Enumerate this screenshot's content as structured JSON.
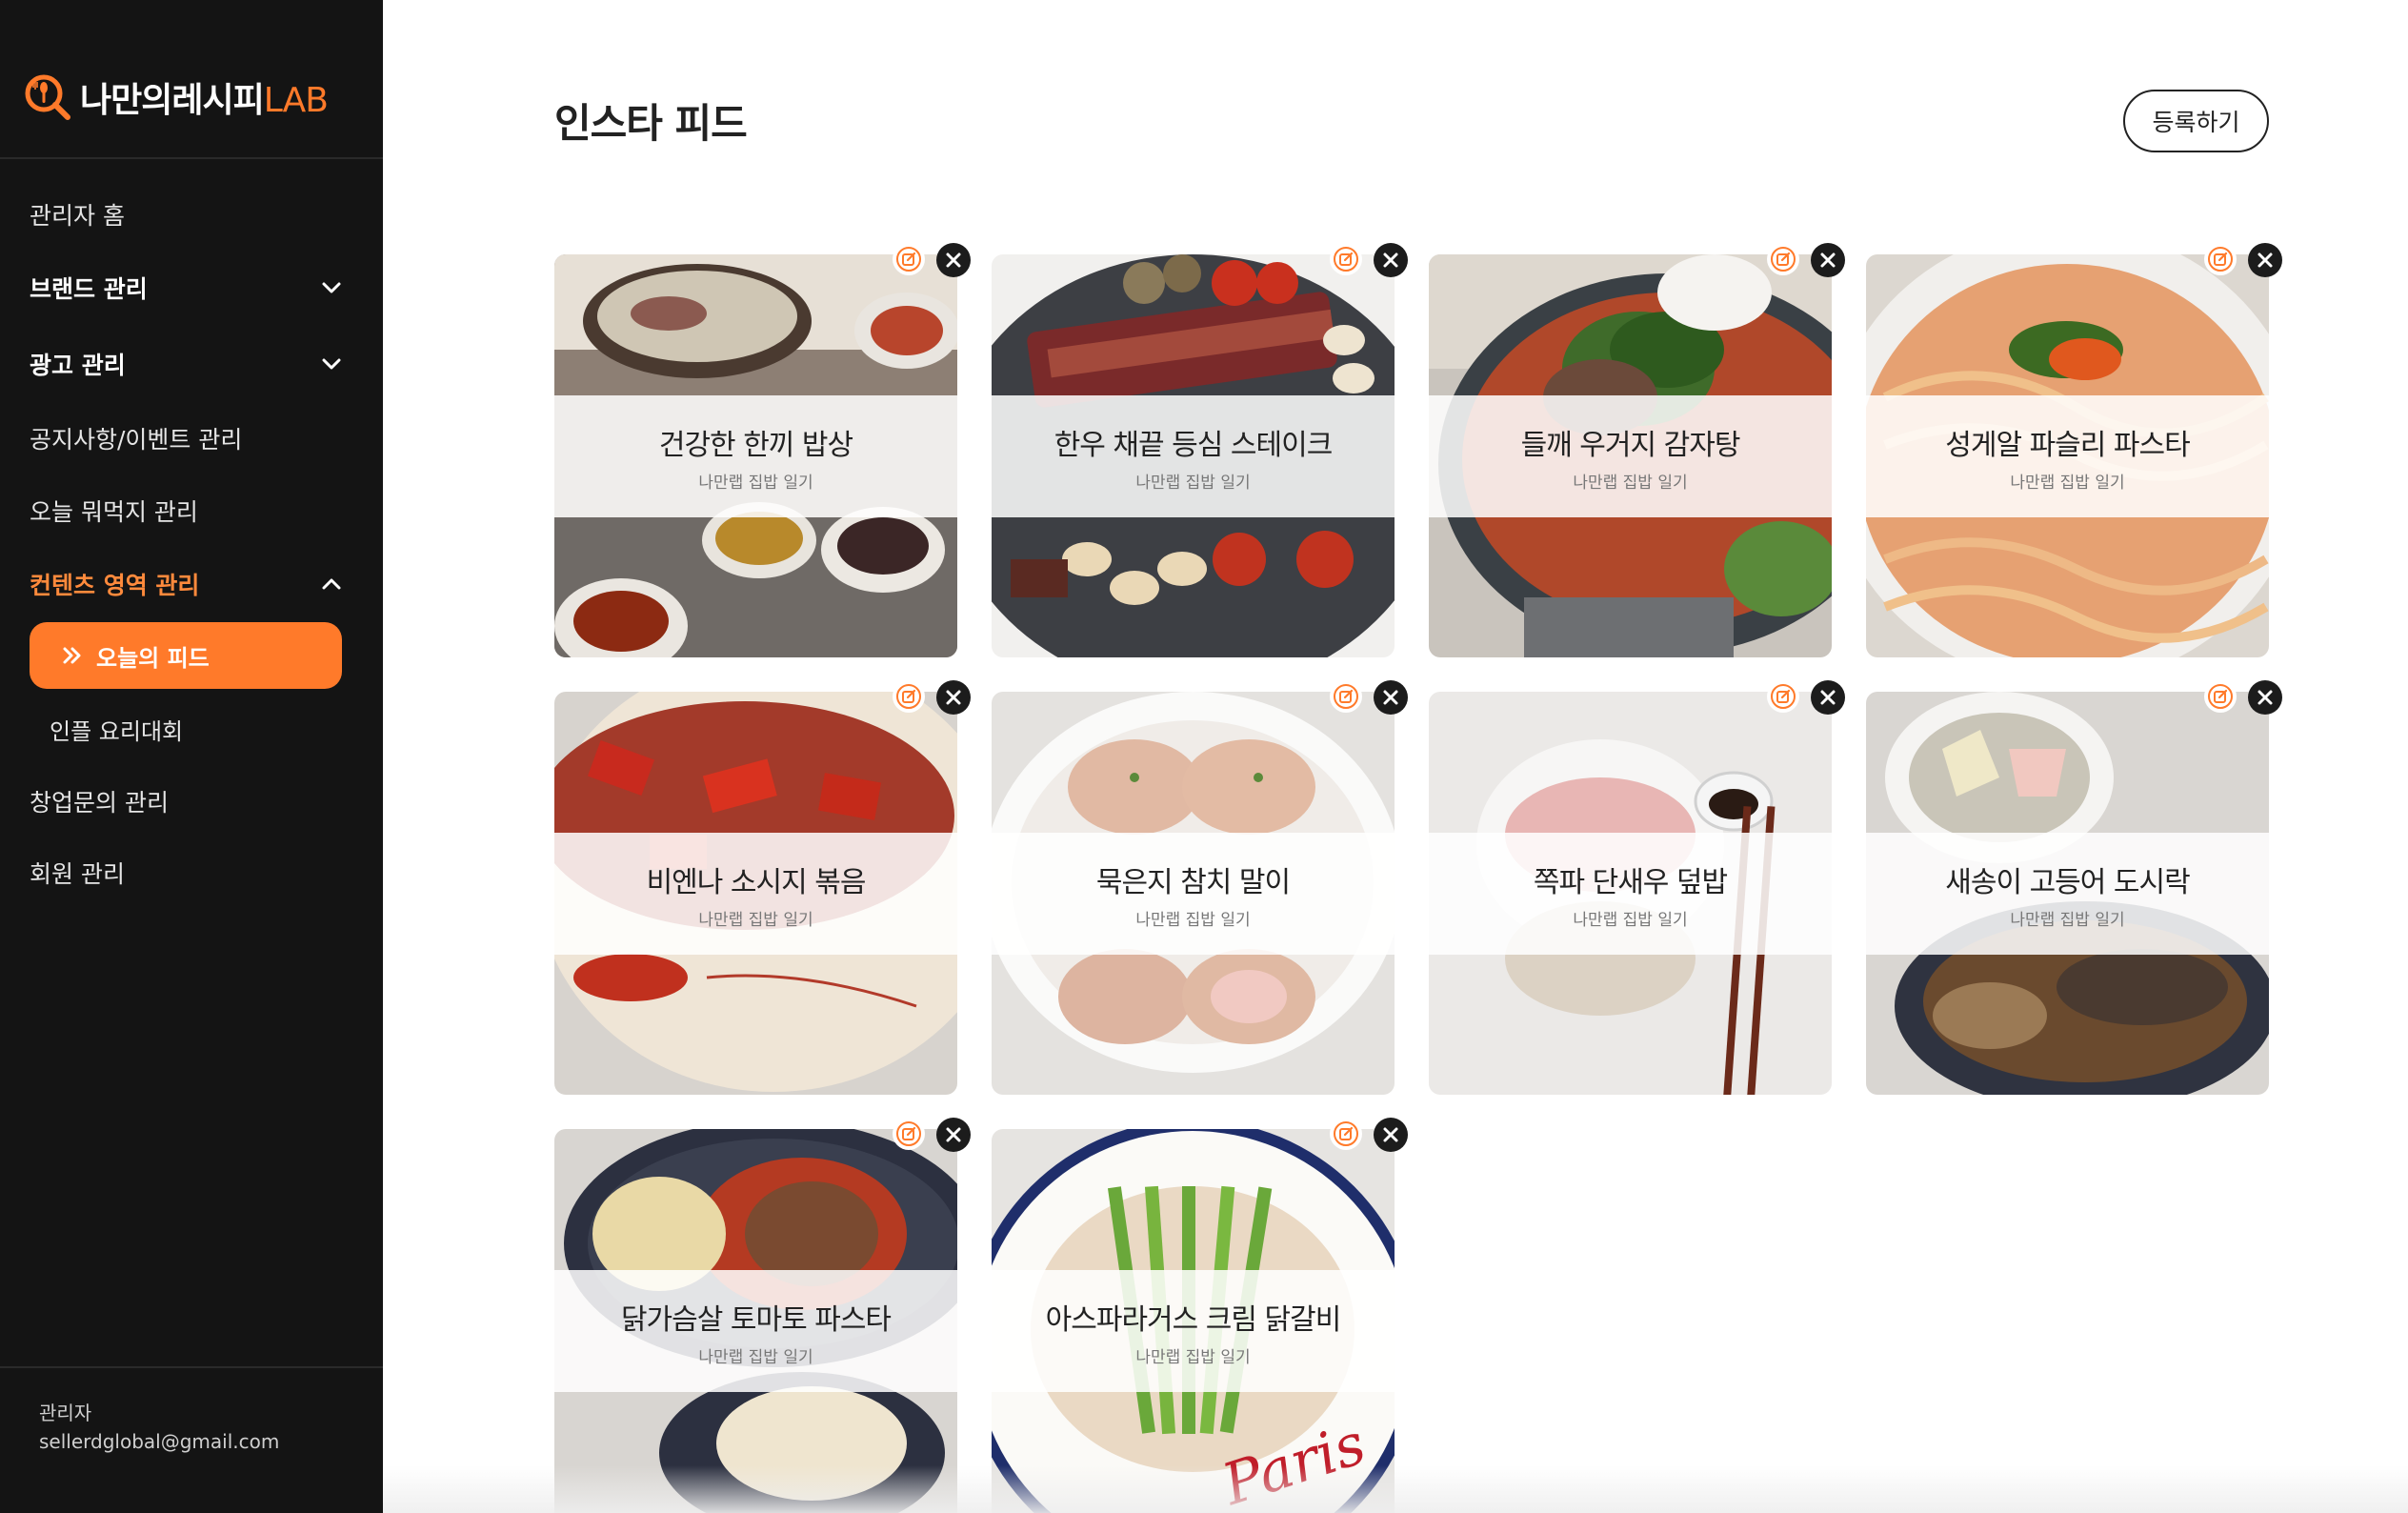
{
  "brand": {
    "name": "나만의레시피",
    "suffix": "LAB"
  },
  "sidebar": {
    "items": [
      {
        "label": "관리자 홈"
      },
      {
        "label": "브랜드 관리"
      },
      {
        "label": "광고 관리"
      },
      {
        "label": "공지사항/이벤트 관리"
      },
      {
        "label": "오늘 뭐먹지 관리"
      },
      {
        "label": "컨텐츠 영역 관리"
      },
      {
        "label": "창업문의 관리"
      },
      {
        "label": "회원 관리"
      }
    ],
    "sub_items": [
      {
        "label": "오늘의 피드"
      },
      {
        "label": "인플 요리대회"
      }
    ],
    "footer": {
      "role": "관리자",
      "email": "sellerdglobal@gmail.com"
    }
  },
  "main": {
    "title": "인스타 피드",
    "register_label": "등록하기",
    "cards": [
      {
        "title": "건강한 한끼 밥상",
        "sub": "나만랩 집밥 일기"
      },
      {
        "title": "한우 채끝 등심 스테이크",
        "sub": "나만랩 집밥 일기"
      },
      {
        "title": "들깨 우거지 감자탕",
        "sub": "나만랩 집밥 일기"
      },
      {
        "title": "성게알 파슬리 파스타",
        "sub": "나만랩 집밥 일기"
      },
      {
        "title": "비엔나 소시지 볶음",
        "sub": "나만랩 집밥 일기"
      },
      {
        "title": "묵은지 참치 말이",
        "sub": "나만랩 집밥 일기"
      },
      {
        "title": "쪽파 단새우 덮밥",
        "sub": "나만랩 집밥 일기"
      },
      {
        "title": "새송이 고등어 도시락",
        "sub": "나만랩 집밥 일기"
      },
      {
        "title": "닭가슴살 토마토 파스타",
        "sub": "나만랩 집밥 일기"
      },
      {
        "title": "아스파라거스 크림 닭갈비",
        "sub": "나만랩 집밥 일기"
      }
    ]
  },
  "colors": {
    "accent": "#ff7a2a",
    "sidebar_bg": "#141414"
  }
}
